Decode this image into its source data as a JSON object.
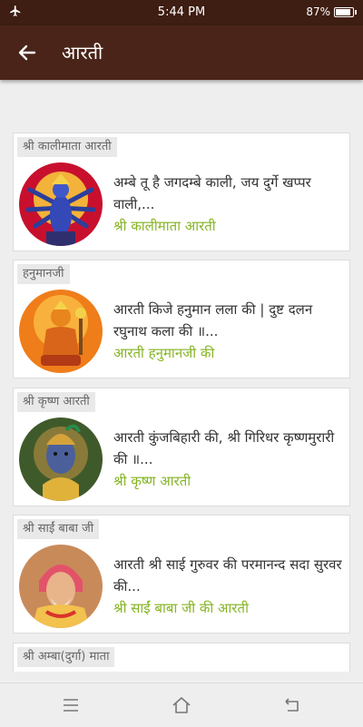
{
  "status": {
    "time": "5:44 PM",
    "battery": "87%",
    "icons": [
      "airplane-mode-icon",
      "battery-icon"
    ]
  },
  "app_bar": {
    "title": "आरती",
    "back_icon": "arrow-left-icon"
  },
  "colors": {
    "status_bar": "#3e1d12",
    "app_bar": "#4a2418",
    "link_green": "#86b424"
  },
  "items": [
    {
      "category": "श्री कालीमाता आरती",
      "description": "अम्बे तू है जगदम्बे काली, जय दुर्गे खप्पर वाली,...",
      "link": "श्री कालीमाता आरती",
      "image": "goddess-kali-icon"
    },
    {
      "category": "हनुमानजी",
      "description": "आरती किजे हनुमान लला की | दुष्ट दलन रघुनाथ कला की ॥...",
      "link": "आरती हनुमानजी की",
      "image": "lord-hanuman-icon"
    },
    {
      "category": "श्री कृष्ण आरती",
      "description": "आरती कुंजबिहारी की, श्री गिरिधर कृष्णमुरारी की ॥...",
      "link": "श्री कृष्ण आरती",
      "image": "lord-krishna-icon"
    },
    {
      "category": "श्री साईं बाबा जी",
      "description": "आरती श्री साई गुरुवर की परमानन्द सदा सुरवर की...",
      "link": "श्री साईं बाबा जी की आरती",
      "image": "sai-baba-icon"
    },
    {
      "category": "श्री अम्बा(दुर्गा) माता",
      "image": "goddess-durga-icon"
    }
  ],
  "nav": {
    "icons": [
      "menu-icon",
      "home-icon",
      "back-icon"
    ]
  }
}
